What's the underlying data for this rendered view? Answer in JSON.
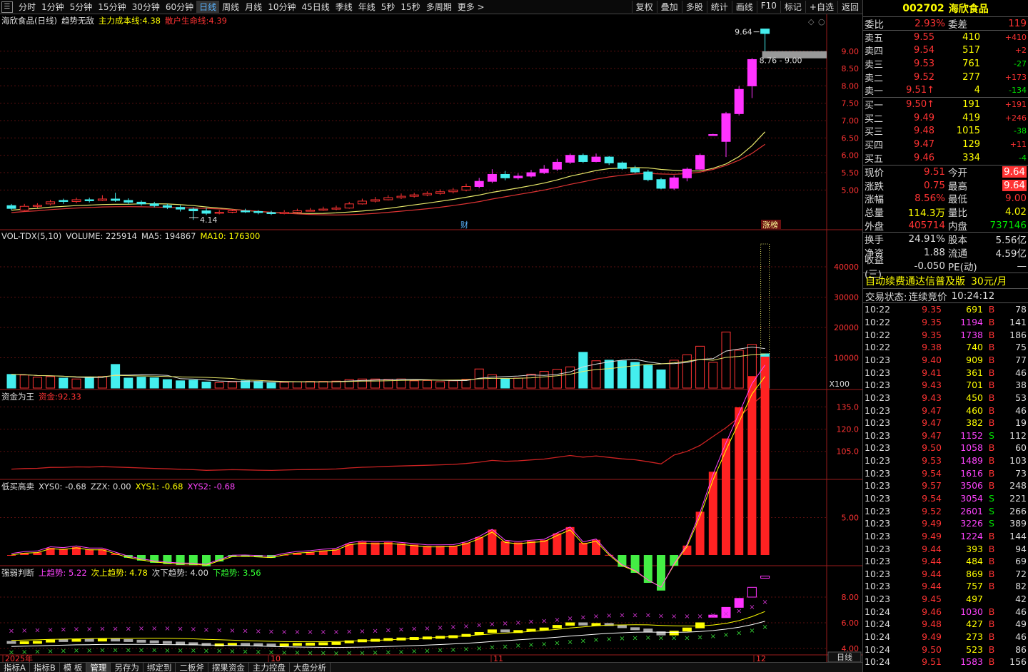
{
  "toolbar": {
    "periods": [
      "分时",
      "1分钟",
      "5分钟",
      "15分钟",
      "30分钟",
      "60分钟",
      "日线",
      "周线",
      "月线",
      "10分钟",
      "45日线",
      "季线",
      "年线",
      "5秒",
      "15秒",
      "多周期",
      "更多 >"
    ],
    "active_period": "日线",
    "right_buttons": [
      "复权",
      "叠加",
      "多股",
      "统计",
      "画线",
      "F10",
      "标记",
      "+自选",
      "返回"
    ]
  },
  "main_pane": {
    "stock_label": "海欣食品(日线)",
    "indicator": "趋势无敌",
    "cost_label": "主力成本线:",
    "cost_value": "4.38",
    "life_label": "散户生命线:",
    "life_value": "4.39",
    "high_label": "9.64",
    "low_label": "4.14",
    "range_label": "8.76 - 9.00",
    "cai_label": "财",
    "zt_label": "涨榜",
    "y_ticks": [
      "9.00",
      "8.50",
      "8.00",
      "7.50",
      "7.00",
      "6.50",
      "6.00",
      "5.50",
      "5.00"
    ]
  },
  "vol_pane": {
    "label": "VOL-TDX(5,10)",
    "volume_label": "VOLUME:",
    "volume_value": "225914",
    "ma5_label": "MA5:",
    "ma5_value": "194867",
    "ma10_label": "MA10:",
    "ma10_value": "176300",
    "y_ticks": [
      "40000",
      "30000",
      "20000",
      "10000"
    ],
    "unit": "X100"
  },
  "fund_pane": {
    "label": "资金为王",
    "fund_label": "资金:",
    "fund_value": "92.33",
    "y_ticks": [
      "135.0",
      "120.0",
      "105.0"
    ]
  },
  "buysell_pane": {
    "label": "低买高卖",
    "xys0_label": "XYS0:",
    "xys0_value": "-0.68",
    "zzx_label": "ZZX:",
    "zzx_value": "0.00",
    "xys1_label": "XYS1:",
    "xys1_value": "-0.68",
    "xys2_label": "XYS2:",
    "xys2_value": "-0.68",
    "y_ticks": [
      "5.00"
    ]
  },
  "trend_pane": {
    "label": "强弱判断",
    "up_label": "上趋势:",
    "up_value": "5.22",
    "up2_label": "次上趋势:",
    "up2_value": "4.78",
    "down2_label": "次下趋势:",
    "down2_value": "4.00",
    "down_label": "下趋势:",
    "down_value": "3.56",
    "y_ticks": [
      "8.00",
      "6.00",
      "4.00"
    ]
  },
  "x_axis": {
    "labels": [
      "2025年",
      "10",
      "11",
      "12"
    ],
    "period_box": "日线"
  },
  "bottom_tabs": [
    "指标A",
    "指标B",
    "模 板",
    "管理",
    "另存为",
    "绑定到",
    "二板斧",
    "摆果资金",
    "主力控盘",
    "大盘分析"
  ],
  "active_bottom_tab": "管理",
  "quote": {
    "code": "002702",
    "name": "海欣食品",
    "weibi_label": "委比",
    "weibi_value": "2.93%",
    "weicha_label": "委差",
    "weicha_value": "119",
    "asks": [
      {
        "label": "卖五",
        "price": "9.55",
        "vol": "410",
        "delta": "+410"
      },
      {
        "label": "卖四",
        "price": "9.54",
        "vol": "517",
        "delta": "+2"
      },
      {
        "label": "卖三",
        "price": "9.53",
        "vol": "761",
        "delta": "-27"
      },
      {
        "label": "卖二",
        "price": "9.52",
        "vol": "277",
        "delta": "+173"
      },
      {
        "label": "卖一",
        "price": "9.51↑",
        "vol": "4",
        "delta": "-134"
      }
    ],
    "bids": [
      {
        "label": "买一",
        "price": "9.50↑",
        "vol": "191",
        "delta": "+191"
      },
      {
        "label": "买二",
        "price": "9.49",
        "vol": "419",
        "delta": "+246"
      },
      {
        "label": "买三",
        "price": "9.48",
        "vol": "1015",
        "delta": "-38"
      },
      {
        "label": "买四",
        "price": "9.47",
        "vol": "129",
        "delta": "+11"
      },
      {
        "label": "买五",
        "price": "9.46",
        "vol": "334",
        "delta": "-4"
      }
    ],
    "stats1": [
      {
        "k": "现价",
        "v": "9.51",
        "k2": "今开",
        "v2": "9.64"
      },
      {
        "k": "涨跌",
        "v": "0.75",
        "k2": "最高",
        "v2": "9.64"
      },
      {
        "k": "涨幅",
        "v": "8.56%",
        "k2": "最低",
        "v2": "9.00"
      },
      {
        "k": "总量",
        "v": "114.3万",
        "k2": "量比",
        "v2": "4.02"
      },
      {
        "k": "外盘",
        "v": "405714",
        "k2": "内盘",
        "v2": "737146"
      }
    ],
    "stats2": [
      {
        "k": "换手",
        "v": "24.91%",
        "k2": "股本",
        "v2": "5.56亿"
      },
      {
        "k": "净资",
        "v": "1.88",
        "k2": "流通",
        "v2": "4.59亿"
      },
      {
        "k": "收益(三)",
        "v": "-0.050",
        "k2": "PE(动)",
        "v2": "—"
      }
    ],
    "ad_text": "自动续费通达信普及版",
    "ad_price": "30元/月",
    "status_label": "交易状态:",
    "status_value": "连续竞价",
    "status_time": "10:24:12"
  },
  "ticks": [
    {
      "t": "10:22",
      "p": "9.35",
      "v": "691",
      "s": "B",
      "n": "78"
    },
    {
      "t": "10:22",
      "p": "9.35",
      "v": "1194",
      "s": "B",
      "n": "141"
    },
    {
      "t": "10:22",
      "p": "9.35",
      "v": "1738",
      "s": "B",
      "n": "186"
    },
    {
      "t": "10:22",
      "p": "9.38",
      "v": "740",
      "s": "B",
      "n": "75"
    },
    {
      "t": "10:23",
      "p": "9.40",
      "v": "909",
      "s": "B",
      "n": "77"
    },
    {
      "t": "10:23",
      "p": "9.41",
      "v": "361",
      "s": "B",
      "n": "46"
    },
    {
      "t": "10:23",
      "p": "9.43",
      "v": "701",
      "s": "B",
      "n": "38"
    },
    {
      "t": "10:23",
      "p": "9.43",
      "v": "450",
      "s": "B",
      "n": "53"
    },
    {
      "t": "10:23",
      "p": "9.47",
      "v": "460",
      "s": "B",
      "n": "46"
    },
    {
      "t": "10:23",
      "p": "9.47",
      "v": "382",
      "s": "B",
      "n": "19"
    },
    {
      "t": "10:23",
      "p": "9.47",
      "v": "1152",
      "s": "S",
      "n": "112"
    },
    {
      "t": "10:23",
      "p": "9.50",
      "v": "1058",
      "s": "B",
      "n": "60"
    },
    {
      "t": "10:23",
      "p": "9.53",
      "v": "1489",
      "s": "B",
      "n": "103"
    },
    {
      "t": "10:23",
      "p": "9.54",
      "v": "1616",
      "s": "B",
      "n": "73"
    },
    {
      "t": "10:23",
      "p": "9.57",
      "v": "3506",
      "s": "B",
      "n": "248"
    },
    {
      "t": "10:23",
      "p": "9.54",
      "v": "3054",
      "s": "S",
      "n": "221"
    },
    {
      "t": "10:23",
      "p": "9.52",
      "v": "2601",
      "s": "S",
      "n": "266"
    },
    {
      "t": "10:23",
      "p": "9.49",
      "v": "3226",
      "s": "S",
      "n": "389"
    },
    {
      "t": "10:23",
      "p": "9.49",
      "v": "1224",
      "s": "B",
      "n": "144"
    },
    {
      "t": "10:23",
      "p": "9.44",
      "v": "393",
      "s": "B",
      "n": "94"
    },
    {
      "t": "10:23",
      "p": "9.44",
      "v": "484",
      "s": "B",
      "n": "69"
    },
    {
      "t": "10:23",
      "p": "9.44",
      "v": "869",
      "s": "B",
      "n": "72"
    },
    {
      "t": "10:23",
      "p": "9.44",
      "v": "757",
      "s": "B",
      "n": "82"
    },
    {
      "t": "10:23",
      "p": "9.45",
      "v": "497",
      "s": "",
      "n": "42"
    },
    {
      "t": "10:24",
      "p": "9.46",
      "v": "1030",
      "s": "B",
      "n": "46"
    },
    {
      "t": "10:24",
      "p": "9.48",
      "v": "427",
      "s": "B",
      "n": "49"
    },
    {
      "t": "10:24",
      "p": "9.49",
      "v": "273",
      "s": "B",
      "n": "46"
    },
    {
      "t": "10:24",
      "p": "9.50",
      "v": "523",
      "s": "B",
      "n": "86"
    },
    {
      "t": "10:24",
      "p": "9.51",
      "v": "1583",
      "s": "B",
      "n": "156"
    }
  ],
  "chart_data": {
    "type": "candlestick",
    "candles": [
      [
        4.55,
        4.47,
        4.6,
        4.42
      ],
      [
        4.42,
        4.53,
        4.6,
        4.4
      ],
      [
        4.53,
        4.56,
        4.62,
        4.48
      ],
      [
        4.6,
        4.66,
        4.72,
        4.56
      ],
      [
        4.7,
        4.67,
        4.75,
        4.6
      ],
      [
        4.67,
        4.72,
        4.78,
        4.62
      ],
      [
        4.72,
        4.7,
        4.78,
        4.64
      ],
      [
        4.7,
        4.74,
        4.85,
        4.68
      ],
      [
        4.74,
        4.7,
        4.92,
        4.66
      ],
      [
        4.7,
        4.65,
        4.76,
        4.6
      ],
      [
        4.65,
        4.6,
        4.7,
        4.55
      ],
      [
        4.6,
        4.55,
        4.66,
        4.5
      ],
      [
        4.55,
        4.5,
        4.6,
        4.45
      ],
      [
        4.5,
        4.45,
        4.56,
        4.38
      ],
      [
        4.45,
        4.4,
        4.5,
        4.14
      ],
      [
        4.4,
        4.33,
        4.48,
        4.28
      ],
      [
        4.33,
        4.36,
        4.42,
        4.3
      ],
      [
        4.36,
        4.4,
        4.45,
        4.33
      ],
      [
        4.4,
        4.38,
        4.46,
        4.34
      ],
      [
        4.38,
        4.35,
        4.42,
        4.3
      ],
      [
        4.35,
        4.32,
        4.4,
        4.28
      ],
      [
        4.32,
        4.36,
        4.42,
        4.3
      ],
      [
        4.36,
        4.4,
        4.46,
        4.34
      ],
      [
        4.4,
        4.42,
        4.48,
        4.38
      ],
      [
        4.42,
        4.45,
        4.52,
        4.4
      ],
      [
        4.45,
        4.48,
        4.55,
        4.42
      ],
      [
        4.48,
        4.6,
        4.66,
        4.46
      ],
      [
        4.6,
        4.68,
        4.75,
        4.58
      ],
      [
        4.68,
        4.72,
        4.8,
        4.64
      ],
      [
        4.72,
        4.78,
        4.85,
        4.7
      ],
      [
        4.78,
        4.82,
        4.9,
        4.74
      ],
      [
        4.82,
        4.86,
        4.92,
        4.78
      ],
      [
        4.86,
        4.9,
        4.96,
        4.82
      ],
      [
        4.9,
        4.95,
        5.02,
        4.86
      ],
      [
        4.95,
        5.0,
        5.06,
        4.9
      ],
      [
        5.0,
        5.1,
        5.18,
        4.96
      ],
      [
        5.1,
        5.25,
        5.35,
        5.05
      ],
      [
        5.25,
        5.45,
        5.6,
        5.2
      ],
      [
        5.45,
        5.35,
        5.55,
        5.28
      ],
      [
        5.35,
        5.4,
        5.48,
        5.3
      ],
      [
        5.4,
        5.5,
        5.58,
        5.36
      ],
      [
        5.5,
        5.6,
        5.72,
        5.46
      ],
      [
        5.6,
        5.8,
        5.9,
        5.55
      ],
      [
        5.8,
        6.0,
        6.05,
        5.75
      ],
      [
        6.0,
        5.82,
        6.05,
        5.78
      ],
      [
        5.82,
        5.95,
        6.05,
        5.8
      ],
      [
        5.95,
        5.78,
        5.98,
        5.72
      ],
      [
        5.78,
        5.62,
        5.82,
        5.58
      ],
      [
        5.62,
        5.52,
        5.7,
        5.48
      ],
      [
        5.52,
        5.3,
        5.58,
        5.25
      ],
      [
        5.3,
        5.05,
        5.35,
        5.02
      ],
      [
        5.05,
        5.35,
        5.42,
        5.0
      ],
      [
        5.35,
        5.6,
        5.65,
        5.25
      ],
      [
        5.6,
        6.0,
        6.05,
        5.58
      ],
      [
        6.6,
        6.6,
        6.62,
        6.58
      ],
      [
        6.4,
        7.2,
        7.25,
        5.95
      ],
      [
        7.2,
        7.9,
        8.0,
        7.15
      ],
      [
        8.0,
        8.76,
        8.8,
        7.65
      ],
      [
        9.64,
        9.51,
        9.64,
        9.0
      ]
    ],
    "ylabel": "",
    "ylim": [
      4.0,
      9.9
    ]
  }
}
